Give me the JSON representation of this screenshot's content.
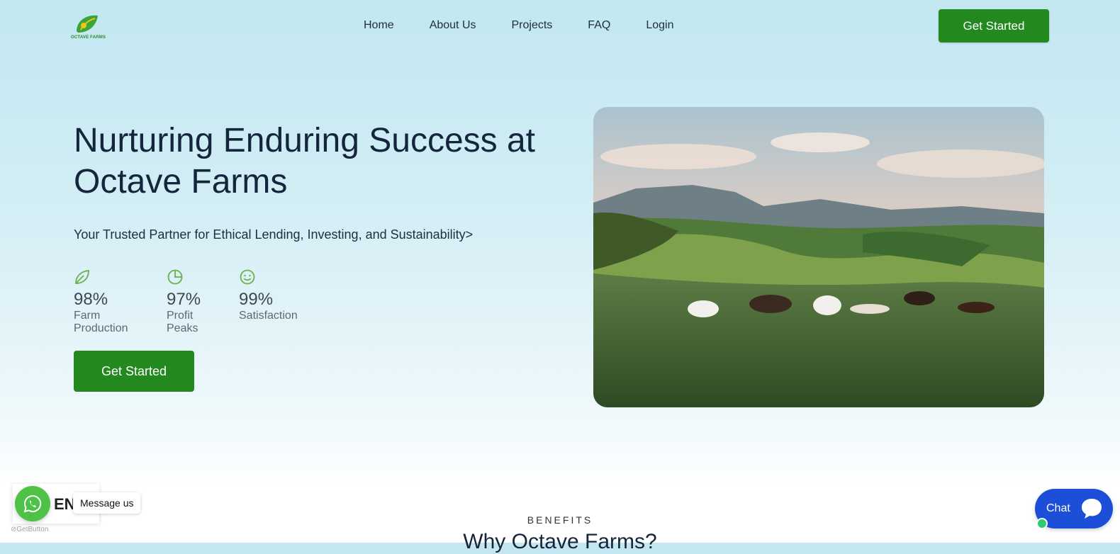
{
  "brand": {
    "logo_text": "OCTAVE FARMS"
  },
  "nav": {
    "items": [
      {
        "label": "Home"
      },
      {
        "label": "About Us"
      },
      {
        "label": "Projects"
      },
      {
        "label": "FAQ"
      },
      {
        "label": "Login"
      }
    ],
    "cta_label": "Get Started"
  },
  "hero": {
    "title": "Nurturing Enduring Success at Octave Farms",
    "subtitle": "Your Trusted Partner for Ethical Lending, Investing, and Sustainability>",
    "stats": [
      {
        "icon": "leaf-icon",
        "value": "98%",
        "label": "Farm Production"
      },
      {
        "icon": "pie-chart-icon",
        "value": "97%",
        "label": "Profit Peaks"
      },
      {
        "icon": "smile-icon",
        "value": "99%",
        "label": "Satisfaction"
      }
    ],
    "cta_label": "Get Started",
    "image_alt": "cattle grazing on green hills"
  },
  "benefits": {
    "eyebrow": "BENEFITS",
    "title": "Why Octave Farms?"
  },
  "widgets": {
    "whatsapp_label": "EN",
    "whatsapp_tooltip": "Message us",
    "getbutton_mark": "GetButton",
    "chat_label": "Chat"
  },
  "colors": {
    "brand_green": "#23891f",
    "heading": "#14253d",
    "chat_blue": "#1d4ed8",
    "whatsapp_green": "#4dc247"
  }
}
